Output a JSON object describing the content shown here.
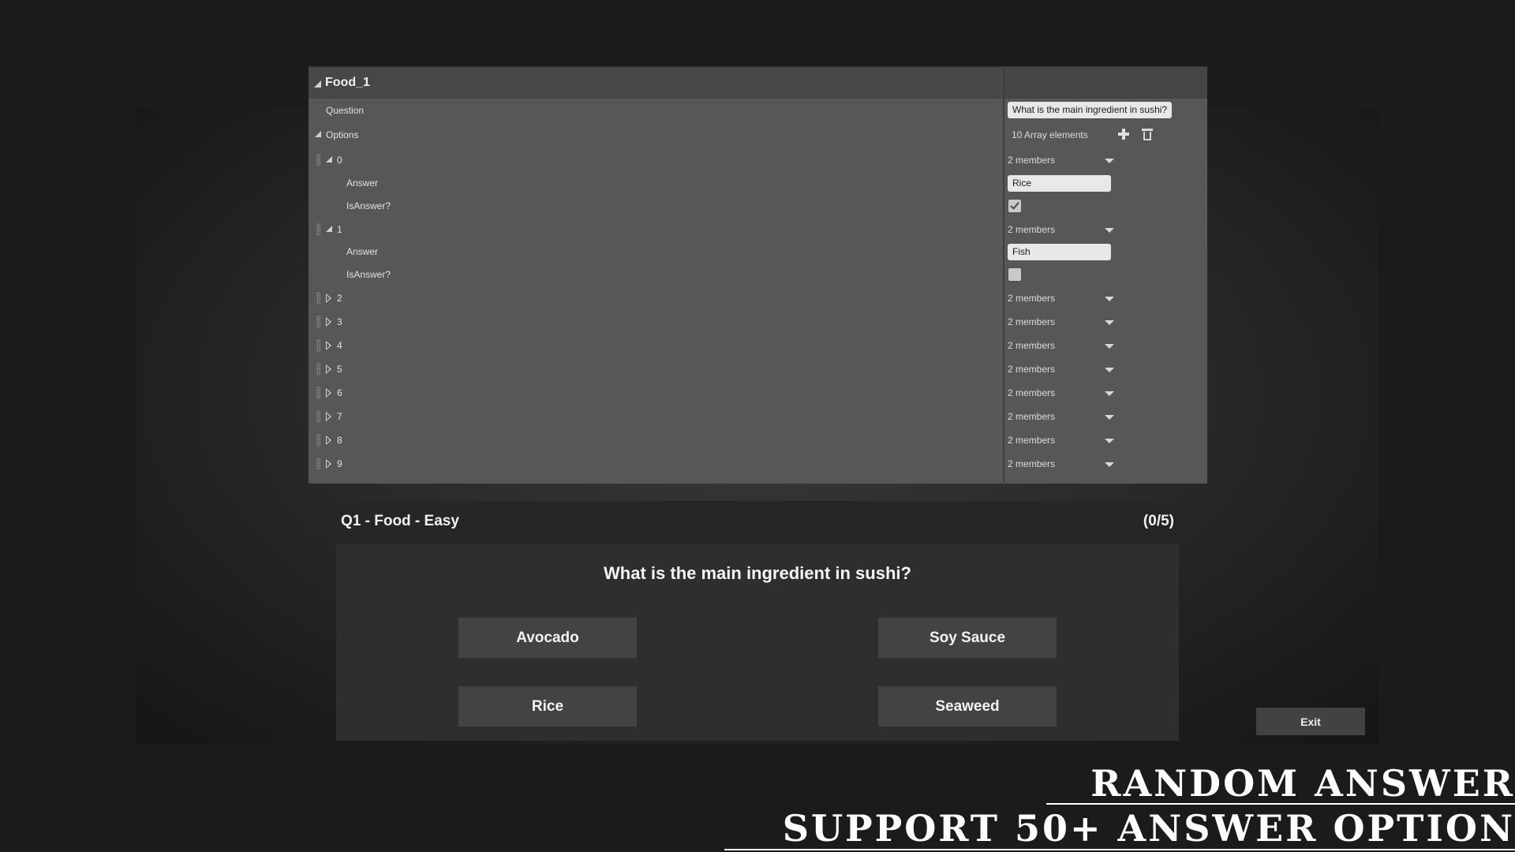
{
  "details": {
    "struct_name": "Food_1",
    "question_label": "Question",
    "question_value": "What is the main ingredient in sushi?",
    "options_label": "Options",
    "options_count": "10 Array elements",
    "elements": [
      {
        "index": "0",
        "summary": "2 members",
        "expanded": true,
        "answer_label": "Answer",
        "answer": "Rice",
        "isanswer_label": "IsAnswer?",
        "is_answer": true
      },
      {
        "index": "1",
        "summary": "2 members",
        "expanded": true,
        "answer_label": "Answer",
        "answer": "Fish",
        "isanswer_label": "IsAnswer?",
        "is_answer": false
      },
      {
        "index": "2",
        "summary": "2 members"
      },
      {
        "index": "3",
        "summary": "2 members"
      },
      {
        "index": "4",
        "summary": "2 members"
      },
      {
        "index": "5",
        "summary": "2 members"
      },
      {
        "index": "6",
        "summary": "2 members"
      },
      {
        "index": "7",
        "summary": "2 members"
      },
      {
        "index": "8",
        "summary": "2 members"
      },
      {
        "index": "9",
        "summary": "2 members"
      }
    ]
  },
  "quiz": {
    "title": "Q1 - Food - Easy",
    "progress": "(0/5)",
    "question": "What is the main ingredient in sushi?",
    "answers": [
      "Avocado",
      "Soy Sauce",
      "Rice",
      "Seaweed"
    ]
  },
  "exit_label": "Exit",
  "banner": {
    "line1": "Random Answer",
    "line2": "Support 50+ Answer Option"
  },
  "icons": {
    "add": "plus-icon",
    "delete": "trash-icon",
    "dropdown": "chevron-down-icon",
    "checkbox": "check-icon"
  }
}
